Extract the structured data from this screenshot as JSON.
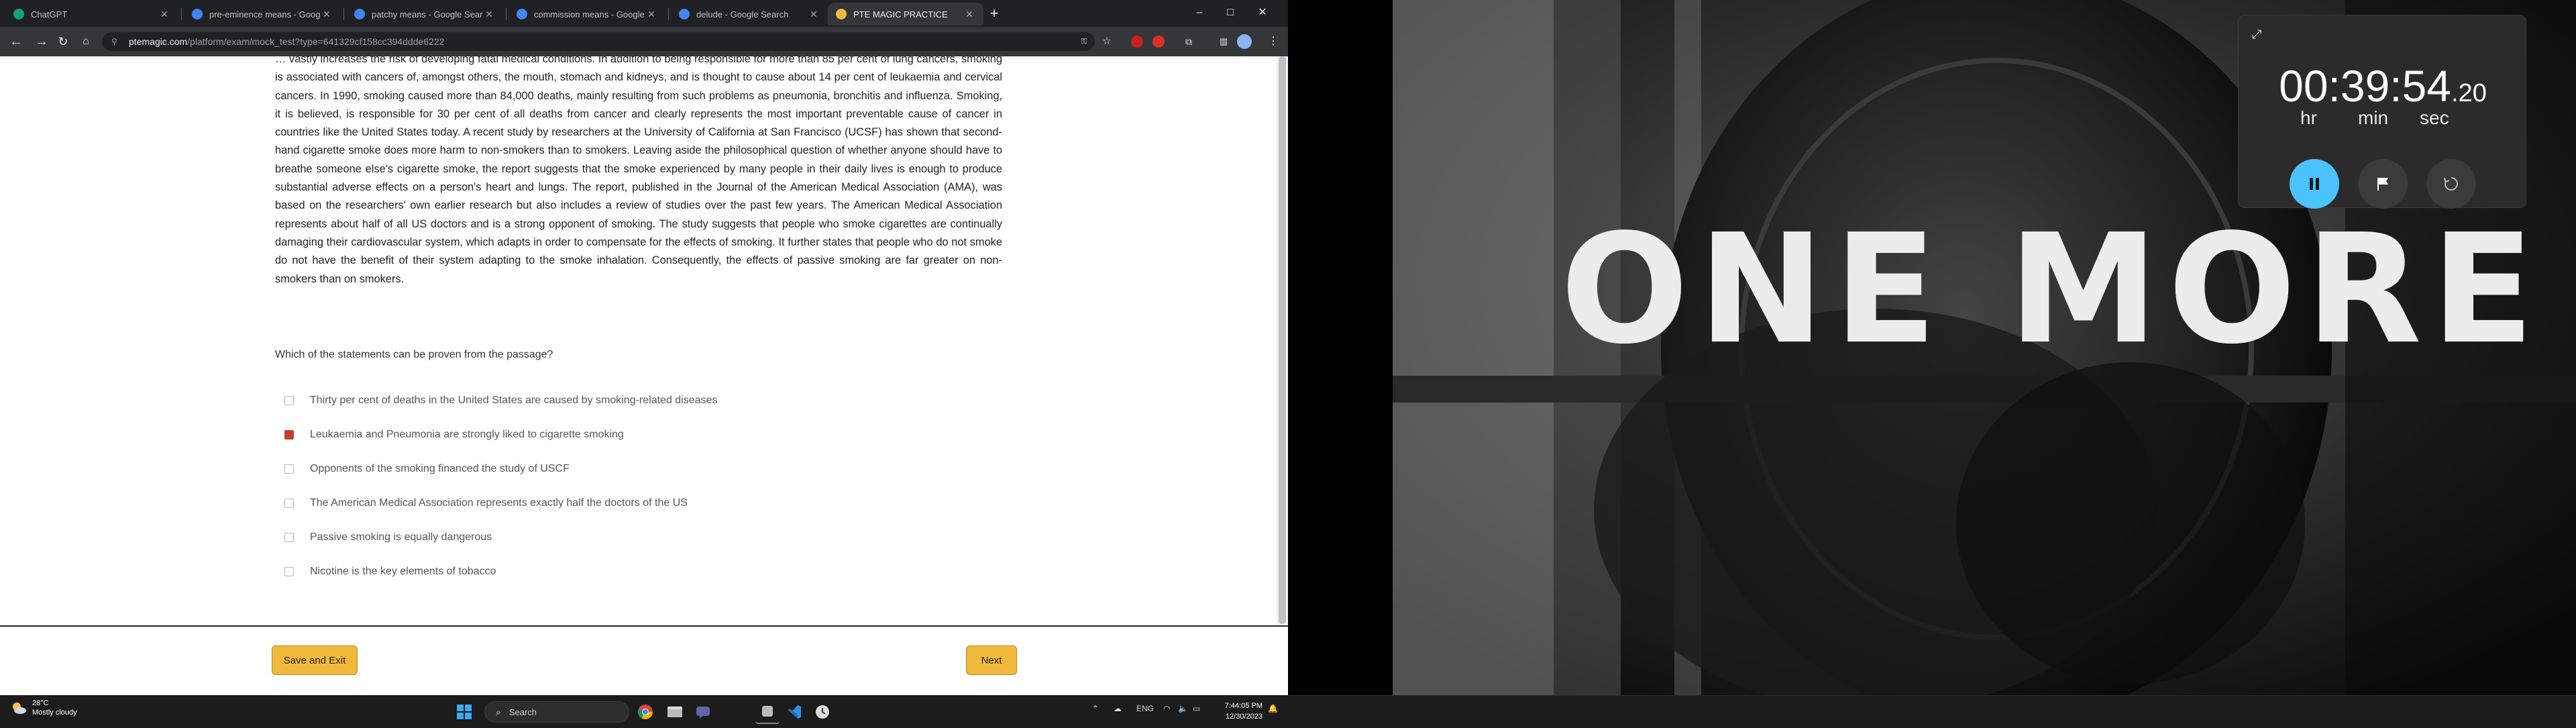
{
  "browser": {
    "tabs": [
      {
        "label": "ChatGPT",
        "color": "#10a37f",
        "active": false
      },
      {
        "label": "pre-eminence means - Google",
        "color": "#4285f4",
        "active": false
      },
      {
        "label": "patchy means - Google Search",
        "color": "#4285f4",
        "active": false
      },
      {
        "label": "commission means - Google Se",
        "color": "#4285f4",
        "active": false
      },
      {
        "label": "delude - Google Search",
        "color": "#4285f4",
        "active": false
      },
      {
        "label": "PTE MAGIC PRACTICE",
        "color": "#f0b93b",
        "active": true
      }
    ],
    "url_host": "ptemagic.com",
    "url_path": "/platform/exam/mock_test?type=641329cf158cc394ddde6222",
    "window_controls": {
      "minimize": "–",
      "maximize": "□",
      "close": "✕"
    }
  },
  "exam": {
    "passage": "… vastly increases the risk of developing fatal medical conditions. In addition to being responsible for more than 85 per cent of lung cancers, smoking is associated with cancers of, amongst others, the mouth, stomach and kidneys, and is thought to cause about 14 per cent of leukaemia and cervical cancers. In 1990, smoking caused more than 84,000 deaths, mainly resulting from such problems as pneumonia, bronchitis and influenza. Smoking, it is believed, is responsible for 30 per cent of all deaths from cancer and clearly represents the most important preventable cause of cancer in countries like the United States today. A recent study by researchers at the University of California at San Francisco (UCSF) has shown that second-hand cigarette smoke does more harm to non-smokers than to smokers. Leaving aside the philosophical question of whether anyone should have to breathe someone else's cigarette smoke, the report suggests that the smoke experienced by many people in their daily lives is enough to produce substantial adverse effects on a person's heart and lungs. The report, published in the Journal of the American Medical Association (AMA), was based on the researchers' own earlier research but also includes a review of studies over the past few years. The American Medical Association represents about half of all US doctors and is a strong opponent of smoking. The study suggests that people who smoke cigarettes are continually damaging their cardiovascular system, which adapts in order to compensate for the effects of smoking. It further states that people who do not smoke do not have the benefit of their system adapting to the smoke inhalation. Consequently, the effects of passive smoking are far greater on non-smokers than on smokers.",
    "question": "Which of the statements can be proven from the passage?",
    "options": [
      {
        "label": "Thirty per cent of deaths in the United States are caused by smoking-related diseases",
        "checked": false
      },
      {
        "label": "Leukaemia and Pneumonia are strongly liked to cigarette smoking",
        "checked": true
      },
      {
        "label": "Opponents of the smoking financed the study of USCF",
        "checked": false
      },
      {
        "label": "The American Medical Association represents exactly half the doctors of the US",
        "checked": false
      },
      {
        "label": "Passive smoking is equally dangerous",
        "checked": false
      },
      {
        "label": "Nicotine is the key elements of tobacco",
        "checked": false
      }
    ],
    "save_exit_label": "Save and Exit",
    "next_label": "Next",
    "accent_color": "#f0b93b",
    "checked_color": "#c6402b"
  },
  "wallpaper": {
    "text": "ONE MORE"
  },
  "stopwatch": {
    "time_main": "00:39:54",
    "time_fraction": ".20",
    "unit_hr": "hr",
    "unit_min": "min",
    "unit_sec": "sec",
    "pause_color": "#4cc2ff"
  },
  "taskbar": {
    "weather_temp": "28°C",
    "weather_desc": "Mostly cloudy",
    "search_placeholder": "Search",
    "language": "ENG",
    "time": "7:44:05 PM",
    "date": "12/30/2023"
  }
}
